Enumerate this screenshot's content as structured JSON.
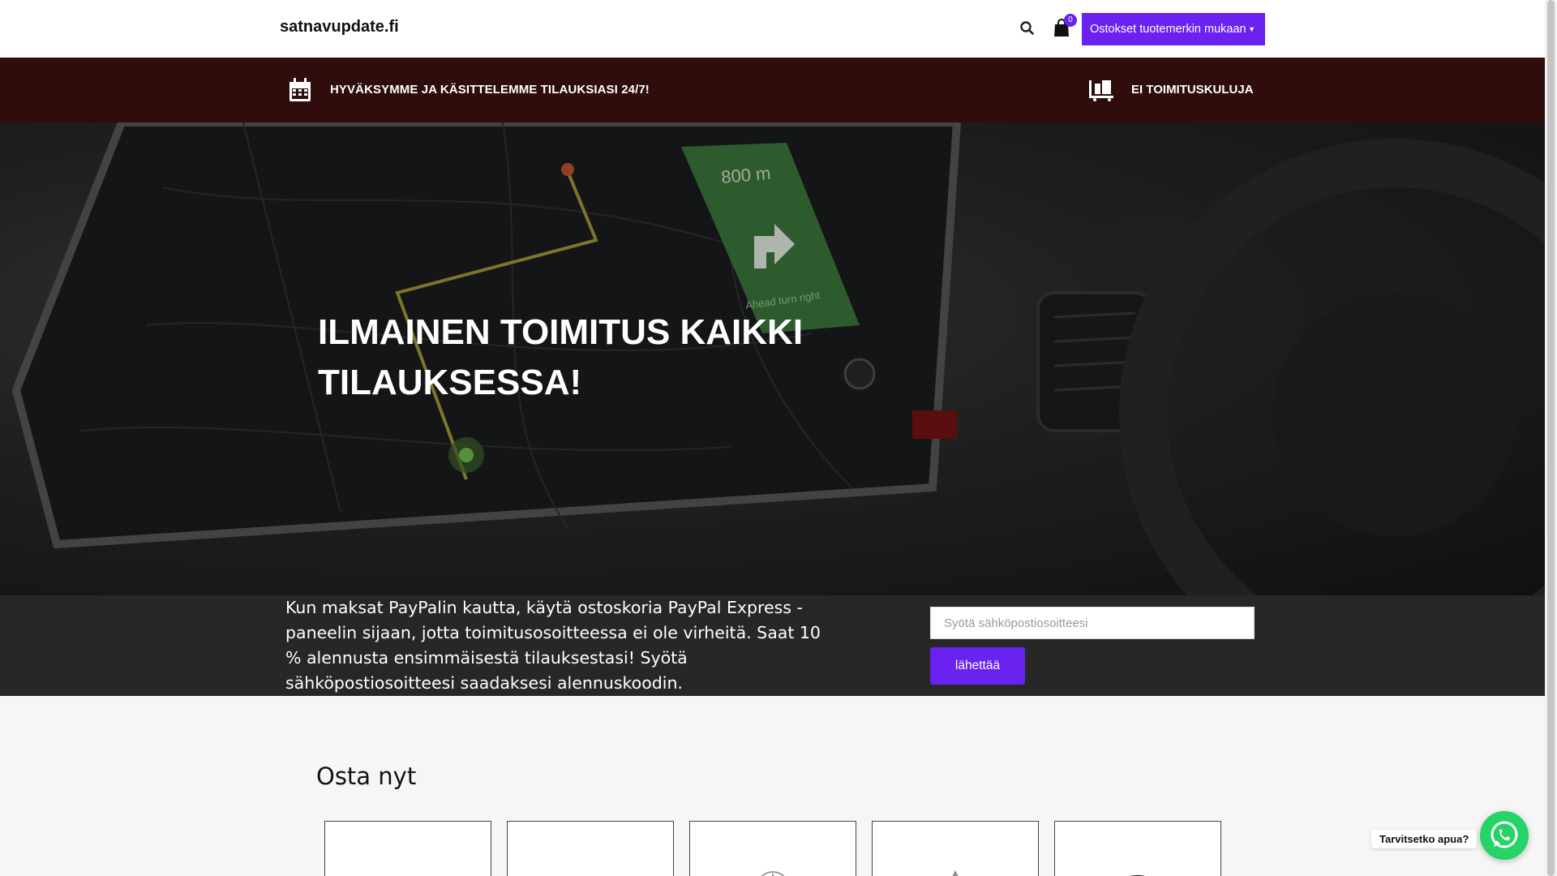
{
  "header": {
    "logo": "satnavupdate.fi",
    "cart_count": "0",
    "brand_dropdown": "Ostokset tuotemerkin mukaan",
    "icons": [
      "search-icon",
      "shopping-bag-icon",
      "caret-down-icon"
    ]
  },
  "info_bar": {
    "left_text": "HYVÄKSYMME JA KÄSITTELEMME TILAUKSIASI 24/7!",
    "right_text": "EI TOIMITUSKULUJA",
    "icons": [
      "calendar-icon",
      "delivery-cart-icon"
    ]
  },
  "hero": {
    "title": "ILMAINEN TOIMITUS KAIKKI TILAUKSESSA!",
    "image_texts": [
      "800 m",
      "Ahead turn right"
    ]
  },
  "subscribe": {
    "text": "Kun maksat PayPalin kautta, käytä ostoskoria PayPal Express -paneelin sijaan, jotta toimitusosoitteessa ei ole virheitä. Saat 10 % alennusta ensimmäisestä tilauksestasi! Syötä sähköpostiosoitteesi saadaksesi alennuskoodin.",
    "email_placeholder": "Syötä sähköpostiosoitteesi",
    "submit_label": "lähettää"
  },
  "shop": {
    "title": "Osta nyt"
  },
  "whatsapp": {
    "label": "Tarvitsetko apua?",
    "icon": "whatsapp-icon"
  },
  "colors": {
    "accent": "#6a22f0",
    "info_bar": "#2f0d0d",
    "strip": "#272727",
    "whatsapp": "#25d366"
  }
}
